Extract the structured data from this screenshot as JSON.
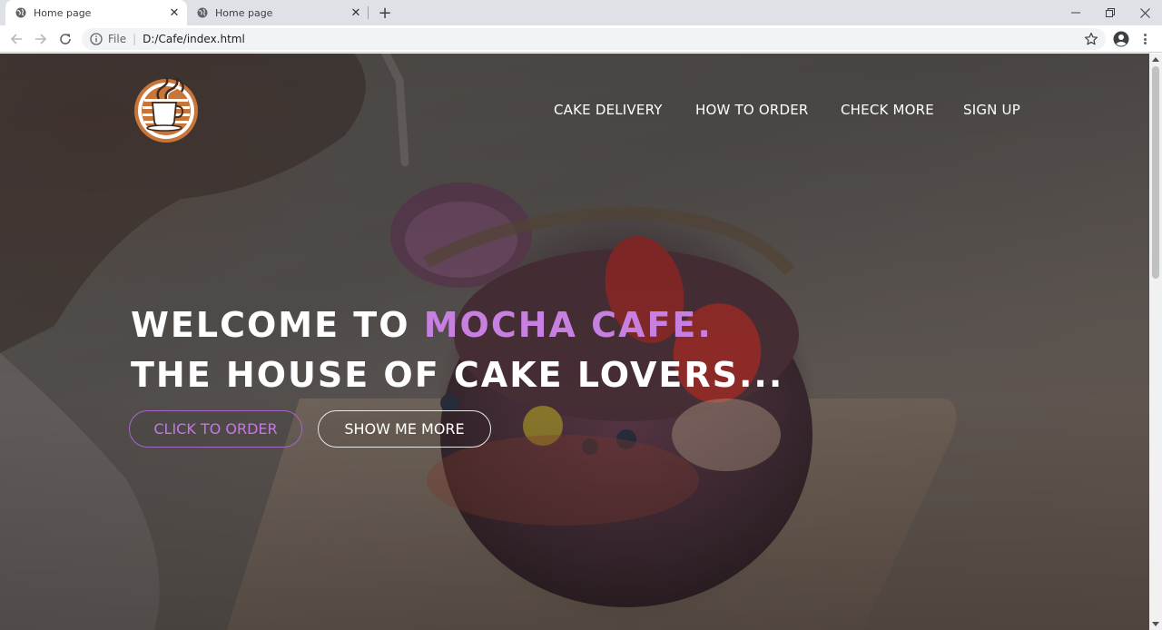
{
  "browser": {
    "tabs": [
      {
        "title": "Home page",
        "active": true
      },
      {
        "title": "Home page",
        "active": false
      }
    ],
    "new_tab_icon": "plus-icon",
    "window_controls": [
      "minimize-icon",
      "maximize-icon",
      "close-icon"
    ],
    "address": {
      "scheme_label": "File",
      "url": "D:/Cafe/index.html"
    }
  },
  "site": {
    "nav": [
      {
        "label": "CAKE DELIVERY"
      },
      {
        "label": "HOW TO ORDER"
      },
      {
        "label": "CHECK MORE"
      },
      {
        "label": "SIGN UP"
      }
    ],
    "hero": {
      "line1_prefix": "WELCOME TO ",
      "line1_accent": "MOCHA CAFE.",
      "line2": "THE HOUSE OF CAKE LOVERS..."
    },
    "buttons": {
      "primary": "CLICK TO ORDER",
      "secondary": "SHOW ME MORE"
    },
    "colors": {
      "accent": "#c77fe0",
      "logo_ring": "#c8753a"
    }
  }
}
